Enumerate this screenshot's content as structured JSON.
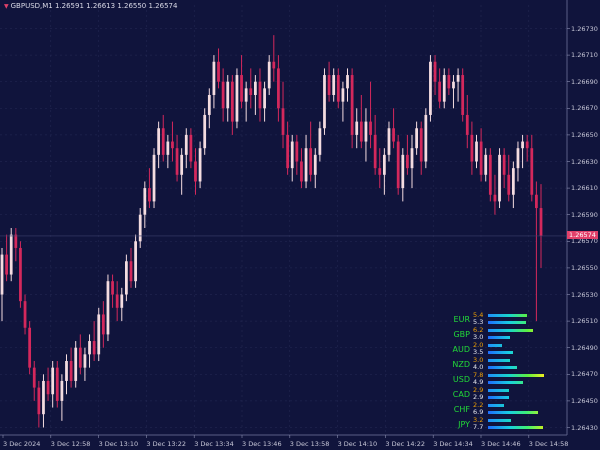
{
  "header": {
    "symbol_line": "GBPUSD,M1  1.26591 1.26613 1.26550 1.26574"
  },
  "price_axis": {
    "labels": [
      "1.26730",
      "1.26710",
      "1.26690",
      "1.26670",
      "1.26650",
      "1.26630",
      "1.26610",
      "1.26590",
      "1.26570",
      "1.26550",
      "1.26530",
      "1.26510",
      "1.26490",
      "1.26470",
      "1.26450",
      "1.26430"
    ],
    "current_price": "1.26574"
  },
  "time_axis": {
    "labels": [
      "3 Dec 2024",
      "3 Dec 12:58",
      "3 Dec 13:10",
      "3 Dec 13:22",
      "3 Dec 13:34",
      "3 Dec 13:46",
      "3 Dec 13:58",
      "3 Dec 14:10",
      "3 Dec 14:22",
      "3 Dec 14:34",
      "3 Dec 14:46",
      "3 Dec 14:58"
    ]
  },
  "colors": {
    "background": "#10143c",
    "bull": "#f4dce0",
    "bear": "#d4285c",
    "grid": "#262a56",
    "accent": "#e0406a",
    "currency_text": "#22d838"
  },
  "strength_meter": [
    {
      "currency": "EUR",
      "v1": "5.4",
      "v2": "5.3",
      "f1": 5.4,
      "f2": 5.3
    },
    {
      "currency": "GBP",
      "v1": "6.2",
      "v2": "3.0",
      "f1": 6.2,
      "f2": 3.0
    },
    {
      "currency": "AUD",
      "v1": "2.0",
      "v2": "3.5",
      "f1": 2.0,
      "f2": 3.5
    },
    {
      "currency": "NZD",
      "v1": "3.0",
      "v2": "4.0",
      "f1": 3.0,
      "f2": 4.0
    },
    {
      "currency": "USD",
      "v1": "7.8",
      "v2": "4.9",
      "f1": 7.8,
      "f2": 4.9
    },
    {
      "currency": "CAD",
      "v1": "2.9",
      "v2": "2.9",
      "f1": 2.9,
      "f2": 2.9
    },
    {
      "currency": "CHF",
      "v1": "2.2",
      "v2": "6.9",
      "f1": 2.2,
      "f2": 6.9
    },
    {
      "currency": "JPY",
      "v1": "3.2",
      "v2": "7.7",
      "f1": 3.2,
      "f2": 7.7
    }
  ],
  "chart_data": {
    "type": "candlestick",
    "symbol": "GBPUSD",
    "timeframe": "M1",
    "ylim": [
      1.2642,
      1.2674
    ],
    "ohlc": [
      [
        1.2653,
        1.26565,
        1.2651,
        1.2656
      ],
      [
        1.2656,
        1.26575,
        1.2654,
        1.26545
      ],
      [
        1.26545,
        1.2658,
        1.2654,
        1.26575
      ],
      [
        1.26575,
        1.2658,
        1.26555,
        1.26565
      ],
      [
        1.26565,
        1.2657,
        1.2652,
        1.26525
      ],
      [
        1.26525,
        1.2653,
        1.265,
        1.26505
      ],
      [
        1.26505,
        1.2651,
        1.2647,
        1.26475
      ],
      [
        1.26475,
        1.2648,
        1.2645,
        1.2646
      ],
      [
        1.2646,
        1.26465,
        1.2643,
        1.2644
      ],
      [
        1.2644,
        1.2647,
        1.2643,
        1.26465
      ],
      [
        1.26465,
        1.26475,
        1.2645,
        1.26455
      ],
      [
        1.26455,
        1.2648,
        1.26445,
        1.26475
      ],
      [
        1.26475,
        1.2648,
        1.26445,
        1.2645
      ],
      [
        1.2645,
        1.2647,
        1.26435,
        1.26465
      ],
      [
        1.26465,
        1.26485,
        1.26455,
        1.2648
      ],
      [
        1.2648,
        1.2649,
        1.2646,
        1.26465
      ],
      [
        1.26465,
        1.26495,
        1.2646,
        1.2649
      ],
      [
        1.2649,
        1.265,
        1.2647,
        1.26475
      ],
      [
        1.26475,
        1.2649,
        1.26465,
        1.26485
      ],
      [
        1.26485,
        1.265,
        1.26475,
        1.26495
      ],
      [
        1.26495,
        1.2651,
        1.2648,
        1.26485
      ],
      [
        1.26485,
        1.2652,
        1.2648,
        1.26515
      ],
      [
        1.26515,
        1.26525,
        1.2649,
        1.265
      ],
      [
        1.265,
        1.26545,
        1.26495,
        1.2654
      ],
      [
        1.2654,
        1.26545,
        1.2652,
        1.2653
      ],
      [
        1.2653,
        1.2654,
        1.2651,
        1.2652
      ],
      [
        1.2652,
        1.26535,
        1.2651,
        1.2653
      ],
      [
        1.2653,
        1.2656,
        1.26525,
        1.26555
      ],
      [
        1.26555,
        1.26565,
        1.26535,
        1.2654
      ],
      [
        1.2654,
        1.26575,
        1.26535,
        1.2657
      ],
      [
        1.2657,
        1.26595,
        1.26565,
        1.2659
      ],
      [
        1.2659,
        1.26615,
        1.2658,
        1.2661
      ],
      [
        1.2661,
        1.26625,
        1.26595,
        1.266
      ],
      [
        1.266,
        1.2664,
        1.26595,
        1.26635
      ],
      [
        1.26635,
        1.2666,
        1.26625,
        1.26655
      ],
      [
        1.26655,
        1.26665,
        1.2663,
        1.26635
      ],
      [
        1.26635,
        1.2665,
        1.26625,
        1.26645
      ],
      [
        1.26645,
        1.2666,
        1.2663,
        1.2664
      ],
      [
        1.2664,
        1.2665,
        1.26615,
        1.2662
      ],
      [
        1.2662,
        1.2664,
        1.26605,
        1.26635
      ],
      [
        1.26635,
        1.26655,
        1.26625,
        1.2665
      ],
      [
        1.2665,
        1.26655,
        1.26625,
        1.2663
      ],
      [
        1.2663,
        1.2664,
        1.26605,
        1.26615
      ],
      [
        1.26615,
        1.26645,
        1.2661,
        1.2664
      ],
      [
        1.2664,
        1.2667,
        1.26635,
        1.26665
      ],
      [
        1.26665,
        1.26685,
        1.26655,
        1.2668
      ],
      [
        1.2668,
        1.2671,
        1.2667,
        1.26705
      ],
      [
        1.26705,
        1.26715,
        1.26685,
        1.2669
      ],
      [
        1.2669,
        1.267,
        1.2666,
        1.2667
      ],
      [
        1.2667,
        1.26695,
        1.2666,
        1.2669
      ],
      [
        1.2669,
        1.26695,
        1.2665,
        1.2666
      ],
      [
        1.2666,
        1.267,
        1.26655,
        1.26695
      ],
      [
        1.26695,
        1.2671,
        1.2667,
        1.26675
      ],
      [
        1.26675,
        1.2669,
        1.2666,
        1.26685
      ],
      [
        1.26685,
        1.267,
        1.2667,
        1.2668
      ],
      [
        1.2668,
        1.26695,
        1.26665,
        1.2669
      ],
      [
        1.2669,
        1.267,
        1.2666,
        1.2667
      ],
      [
        1.2667,
        1.2669,
        1.2666,
        1.26685
      ],
      [
        1.26685,
        1.2671,
        1.2668,
        1.26705
      ],
      [
        1.26705,
        1.26725,
        1.2669,
        1.267
      ],
      [
        1.267,
        1.2671,
        1.2666,
        1.2667
      ],
      [
        1.2667,
        1.2669,
        1.2664,
        1.2665
      ],
      [
        1.2665,
        1.2666,
        1.2662,
        1.26625
      ],
      [
        1.26625,
        1.2665,
        1.26615,
        1.26645
      ],
      [
        1.26645,
        1.2665,
        1.2662,
        1.2663
      ],
      [
        1.2663,
        1.2664,
        1.2661,
        1.26615
      ],
      [
        1.26615,
        1.2665,
        1.2661,
        1.2664
      ],
      [
        1.2664,
        1.2666,
        1.26615,
        1.2662
      ],
      [
        1.2662,
        1.2664,
        1.2661,
        1.26635
      ],
      [
        1.26635,
        1.2666,
        1.2663,
        1.26655
      ],
      [
        1.26655,
        1.267,
        1.2665,
        1.26695
      ],
      [
        1.26695,
        1.26705,
        1.26675,
        1.2668
      ],
      [
        1.2668,
        1.267,
        1.26675,
        1.26695
      ],
      [
        1.26695,
        1.267,
        1.2667,
        1.26675
      ],
      [
        1.26675,
        1.2669,
        1.2666,
        1.26685
      ],
      [
        1.26685,
        1.267,
        1.26675,
        1.26695
      ],
      [
        1.26695,
        1.267,
        1.2664,
        1.2665
      ],
      [
        1.2665,
        1.2667,
        1.2664,
        1.2666
      ],
      [
        1.2666,
        1.2668,
        1.2664,
        1.26645
      ],
      [
        1.26645,
        1.2667,
        1.2663,
        1.2666
      ],
      [
        1.2666,
        1.2669,
        1.2664,
        1.2665
      ],
      [
        1.2665,
        1.26665,
        1.2662,
        1.26625
      ],
      [
        1.26625,
        1.2664,
        1.2661,
        1.2662
      ],
      [
        1.2662,
        1.2664,
        1.26605,
        1.26635
      ],
      [
        1.26635,
        1.2666,
        1.2663,
        1.26655
      ],
      [
        1.26655,
        1.2667,
        1.2664,
        1.26645
      ],
      [
        1.26645,
        1.2665,
        1.26605,
        1.2661
      ],
      [
        1.2661,
        1.2664,
        1.266,
        1.26635
      ],
      [
        1.26635,
        1.2665,
        1.2662,
        1.26625
      ],
      [
        1.26625,
        1.2665,
        1.2661,
        1.2664
      ],
      [
        1.2664,
        1.2666,
        1.26635,
        1.26655
      ],
      [
        1.26655,
        1.2666,
        1.2662,
        1.2663
      ],
      [
        1.2663,
        1.2667,
        1.26625,
        1.26665
      ],
      [
        1.26665,
        1.2671,
        1.2666,
        1.26705
      ],
      [
        1.26705,
        1.2671,
        1.2668,
        1.2669
      ],
      [
        1.2669,
        1.267,
        1.2667,
        1.26675
      ],
      [
        1.26675,
        1.267,
        1.2667,
        1.26695
      ],
      [
        1.26695,
        1.267,
        1.2668,
        1.26685
      ],
      [
        1.26685,
        1.26695,
        1.2667,
        1.2669
      ],
      [
        1.2669,
        1.267,
        1.26675,
        1.26695
      ],
      [
        1.26695,
        1.267,
        1.2666,
        1.26665
      ],
      [
        1.26665,
        1.2668,
        1.2664,
        1.2665
      ],
      [
        1.2665,
        1.2666,
        1.2662,
        1.2663
      ],
      [
        1.2663,
        1.2665,
        1.26625,
        1.26645
      ],
      [
        1.26645,
        1.26655,
        1.26615,
        1.2662
      ],
      [
        1.2662,
        1.2664,
        1.26615,
        1.26635
      ],
      [
        1.26635,
        1.2664,
        1.266,
        1.26605
      ],
      [
        1.26605,
        1.2662,
        1.2659,
        1.266
      ],
      [
        1.266,
        1.2664,
        1.26595,
        1.26635
      ],
      [
        1.26635,
        1.2664,
        1.2661,
        1.2662
      ],
      [
        1.2662,
        1.26635,
        1.266,
        1.26605
      ],
      [
        1.26605,
        1.2663,
        1.26595,
        1.26625
      ],
      [
        1.26625,
        1.26645,
        1.26615,
        1.2664
      ],
      [
        1.2664,
        1.2665,
        1.26625,
        1.26645
      ],
      [
        1.26645,
        1.2665,
        1.2663,
        1.2664
      ],
      [
        1.2664,
        1.2665,
        1.266,
        1.26605
      ],
      [
        1.26605,
        1.26615,
        1.2651,
        1.26595
      ],
      [
        1.26595,
        1.26613,
        1.2655,
        1.26574
      ]
    ]
  }
}
